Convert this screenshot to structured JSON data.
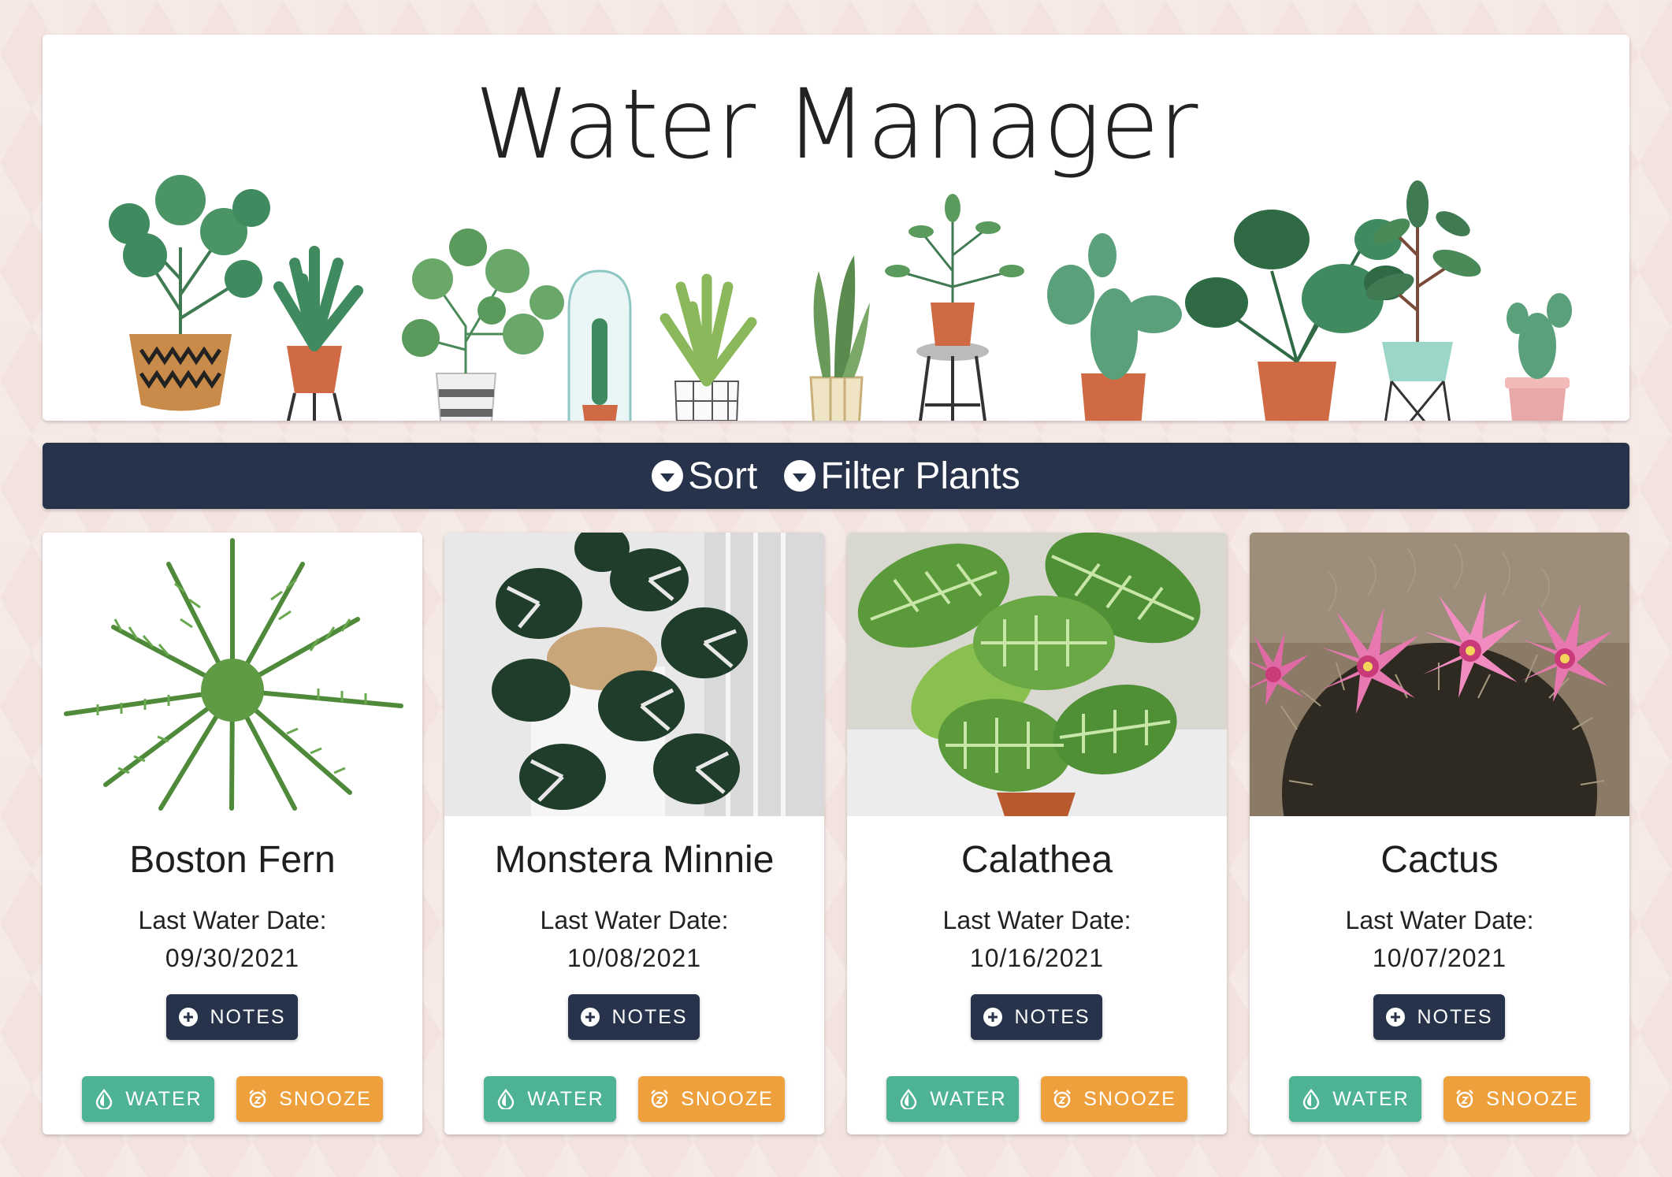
{
  "app": {
    "title": "Water Manager"
  },
  "toolbar": {
    "sort_label": "Sort",
    "filter_label": "Filter Plants"
  },
  "plants": [
    {
      "name": "Boston Fern",
      "last_water_label": "Last Water Date:",
      "last_water_date": "09/30/2021",
      "notes_label": "NOTES",
      "water_label": "WATER",
      "snooze_label": "SNOOZE"
    },
    {
      "name": "Monstera Minnie",
      "last_water_label": "Last Water Date:",
      "last_water_date": "10/08/2021",
      "notes_label": "NOTES",
      "water_label": "WATER",
      "snooze_label": "SNOOZE"
    },
    {
      "name": "Calathea",
      "last_water_label": "Last Water Date:",
      "last_water_date": "10/16/2021",
      "notes_label": "NOTES",
      "water_label": "WATER",
      "snooze_label": "SNOOZE"
    },
    {
      "name": "Cactus",
      "last_water_label": "Last Water Date:",
      "last_water_date": "10/07/2021",
      "notes_label": "NOTES",
      "water_label": "WATER",
      "snooze_label": "SNOOZE"
    }
  ],
  "icons": {
    "sort": "chevron-down-circle-icon",
    "filter": "chevron-down-circle-icon",
    "notes": "plus-circle-icon",
    "water": "water-drop-icon",
    "snooze": "alarm-snooze-icon"
  },
  "colors": {
    "navy": "#26334a",
    "water_green": "#4eb394",
    "snooze_orange": "#eea03c",
    "background": "#f3e3df"
  }
}
